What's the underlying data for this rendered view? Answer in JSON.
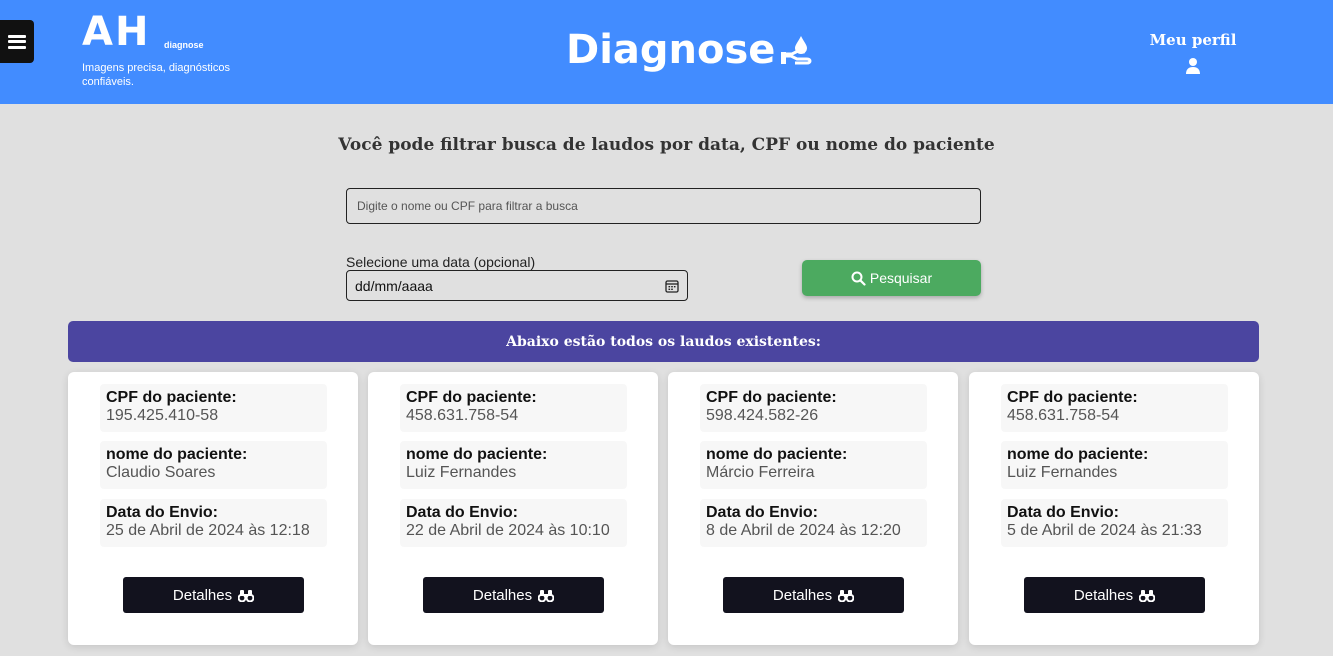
{
  "header": {
    "logo_mark": "AH",
    "logo_small": "diagnose",
    "logo_tagline": "Imagens precisa, diagnósticos confiáveis.",
    "brand": "Diagnose",
    "profile_label": "Meu perfil",
    "background_color": "#428cff"
  },
  "filter": {
    "title": "Você pode filtrar busca de laudos por data, CPF ou nome do paciente",
    "search_placeholder": "Digite o nome ou CPF para filtrar a busca",
    "date_label": "Selecione uma data (opcional)",
    "date_value": "dd/mm/aaaa",
    "search_button": "Pesquisar",
    "search_button_color": "#4caa60"
  },
  "banner": {
    "text": "Abaixo estão todos os laudos existentes:",
    "color": "#4b45a0"
  },
  "labels": {
    "cpf": "CPF do paciente:",
    "name": "nome do paciente:",
    "date": "Data do Envio:",
    "details_button": "Detalhes"
  },
  "reports": [
    {
      "cpf": "195.425.410-58",
      "name": "Claudio Soares",
      "date": "25 de Abril de 2024 às 12:18"
    },
    {
      "cpf": "458.631.758-54",
      "name": "Luiz Fernandes",
      "date": "22 de Abril de 2024 às 10:10"
    },
    {
      "cpf": "598.424.582-26",
      "name": "Márcio Ferreira",
      "date": "8 de Abril de 2024 às 12:20"
    },
    {
      "cpf": "458.631.758-54",
      "name": "Luiz Fernandes",
      "date": "5 de Abril de 2024 às 21:33"
    }
  ],
  "icons": {
    "menu": "hamburger-icon",
    "brand": "hand-drop-icon",
    "profile": "user-icon",
    "calendar": "calendar-icon",
    "search": "search-icon",
    "details": "binoculars-icon"
  }
}
